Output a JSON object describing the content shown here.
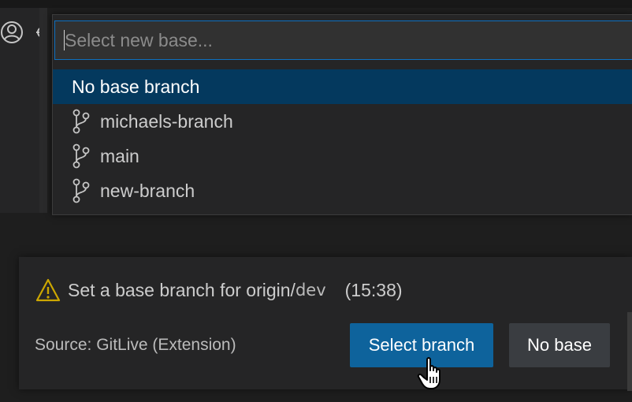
{
  "quick_pick": {
    "placeholder": "Select new base...",
    "items": [
      {
        "label": "No base branch",
        "icon": null,
        "selected": true
      },
      {
        "label": "michaels-branch",
        "icon": "git-branch-icon",
        "selected": false
      },
      {
        "label": "main",
        "icon": "git-branch-icon",
        "selected": false
      },
      {
        "label": "new-branch",
        "icon": "git-branch-icon",
        "selected": false
      }
    ]
  },
  "notification": {
    "icon": "warning-icon",
    "message_prefix": "Set a base branch for origin/",
    "message_branch": "dev",
    "time": "(15:38)",
    "source": "Source: GitLive (Extension)",
    "primary_button": "Select branch",
    "secondary_button": "No base"
  },
  "colors": {
    "accent": "#0e639c",
    "selection": "#04395e",
    "focus_border": "#0e70c0",
    "warning": "#cca700"
  }
}
